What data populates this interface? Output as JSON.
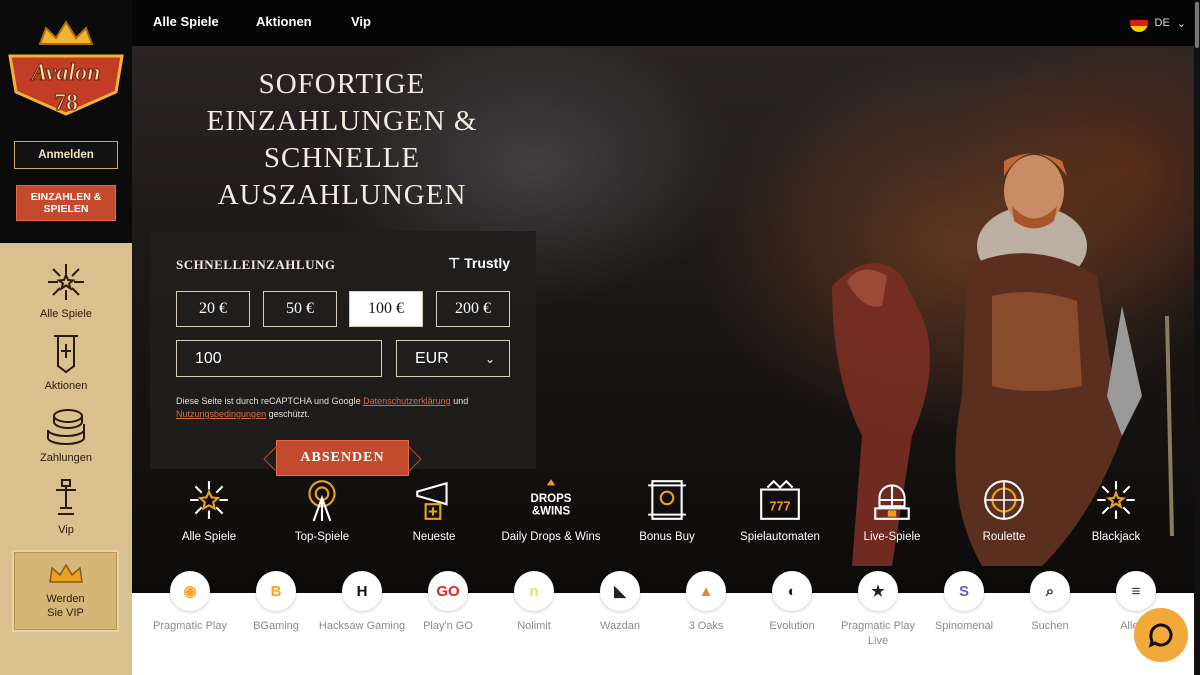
{
  "logo": {
    "name": "Avalon",
    "number": "78"
  },
  "sidebar": {
    "login_label": "Anmelden",
    "deposit_label": "EINZAHLEN & SPIELEN",
    "items": [
      {
        "label": "Alle Spiele",
        "icon": "starburst-icon"
      },
      {
        "label": "Aktionen",
        "icon": "banner-icon"
      },
      {
        "label": "Zahlungen",
        "icon": "coins-icon"
      },
      {
        "label": "Vip",
        "icon": "sword-icon"
      }
    ],
    "vip_card": {
      "line1": "Werden",
      "line2": "Sie VIP",
      "icon": "crown-icon"
    }
  },
  "header": {
    "links": [
      "Alle Spiele",
      "Aktionen",
      "Vip"
    ],
    "language": "DE"
  },
  "hero": {
    "title_lines": [
      "SOFORTIGE",
      "EINZAHLUNGEN &",
      "SCHNELLE",
      "AUSZAHLUNGEN"
    ]
  },
  "quick_deposit": {
    "title": "SCHNELLEINZAHLUNG",
    "provider": "Trustly",
    "amounts": [
      "20 €",
      "50 €",
      "100 €",
      "200 €"
    ],
    "selected_amount_index": 2,
    "amount_value": "100",
    "currency": "EUR",
    "recaptcha_prefix": "Diese Seite ist durch reCAPTCHA und Google",
    "privacy_link": "Datenschutzerklärung",
    "recaptcha_and": "und",
    "terms_link": "Nutzungsbedingungen",
    "recaptcha_suffix": "geschützt.",
    "submit_label": "ABSENDEN"
  },
  "categories": [
    {
      "label": "Alle Spiele",
      "icon": "starburst-icon"
    },
    {
      "label": "Top-Spiele",
      "icon": "target-icon"
    },
    {
      "label": "Neueste",
      "icon": "horn-icon"
    },
    {
      "label": "Daily Drops & Wins",
      "icon": "drops-wins-icon"
    },
    {
      "label": "Bonus Buy",
      "icon": "scroll-icon"
    },
    {
      "label": "Spielautomaten",
      "icon": "slot-machine-icon"
    },
    {
      "label": "Live-Spiele",
      "icon": "knight-helmet-icon"
    },
    {
      "label": "Roulette",
      "icon": "roulette-icon"
    },
    {
      "label": "Blackjack",
      "icon": "sparkle-icon"
    }
  ],
  "providers": [
    {
      "label": "Pragmatic Play",
      "color": "#f5a623"
    },
    {
      "label": "BGaming",
      "color": "#f5a623"
    },
    {
      "label": "Hacksaw Gaming",
      "color": "#111111"
    },
    {
      "label": "Play'n GO",
      "color": "#e3261b"
    },
    {
      "label": "Nolimit",
      "color": "#f0e04a"
    },
    {
      "label": "Wazdan",
      "color": "#222222"
    },
    {
      "label": "3 Oaks",
      "color": "#e0893b"
    },
    {
      "label": "Evolution",
      "color": "#222222"
    },
    {
      "label": "Pragmatic Play Live",
      "color": "#222222"
    },
    {
      "label": "Spinomenal",
      "color": "#6a5acd"
    },
    {
      "label": "Suchen",
      "color": "#333333"
    },
    {
      "label": "Alle Ar",
      "color": "#333333"
    }
  ],
  "colors": {
    "accent": "#c44a2d",
    "gold": "#d9c08f",
    "chat": "#f3a83a"
  }
}
